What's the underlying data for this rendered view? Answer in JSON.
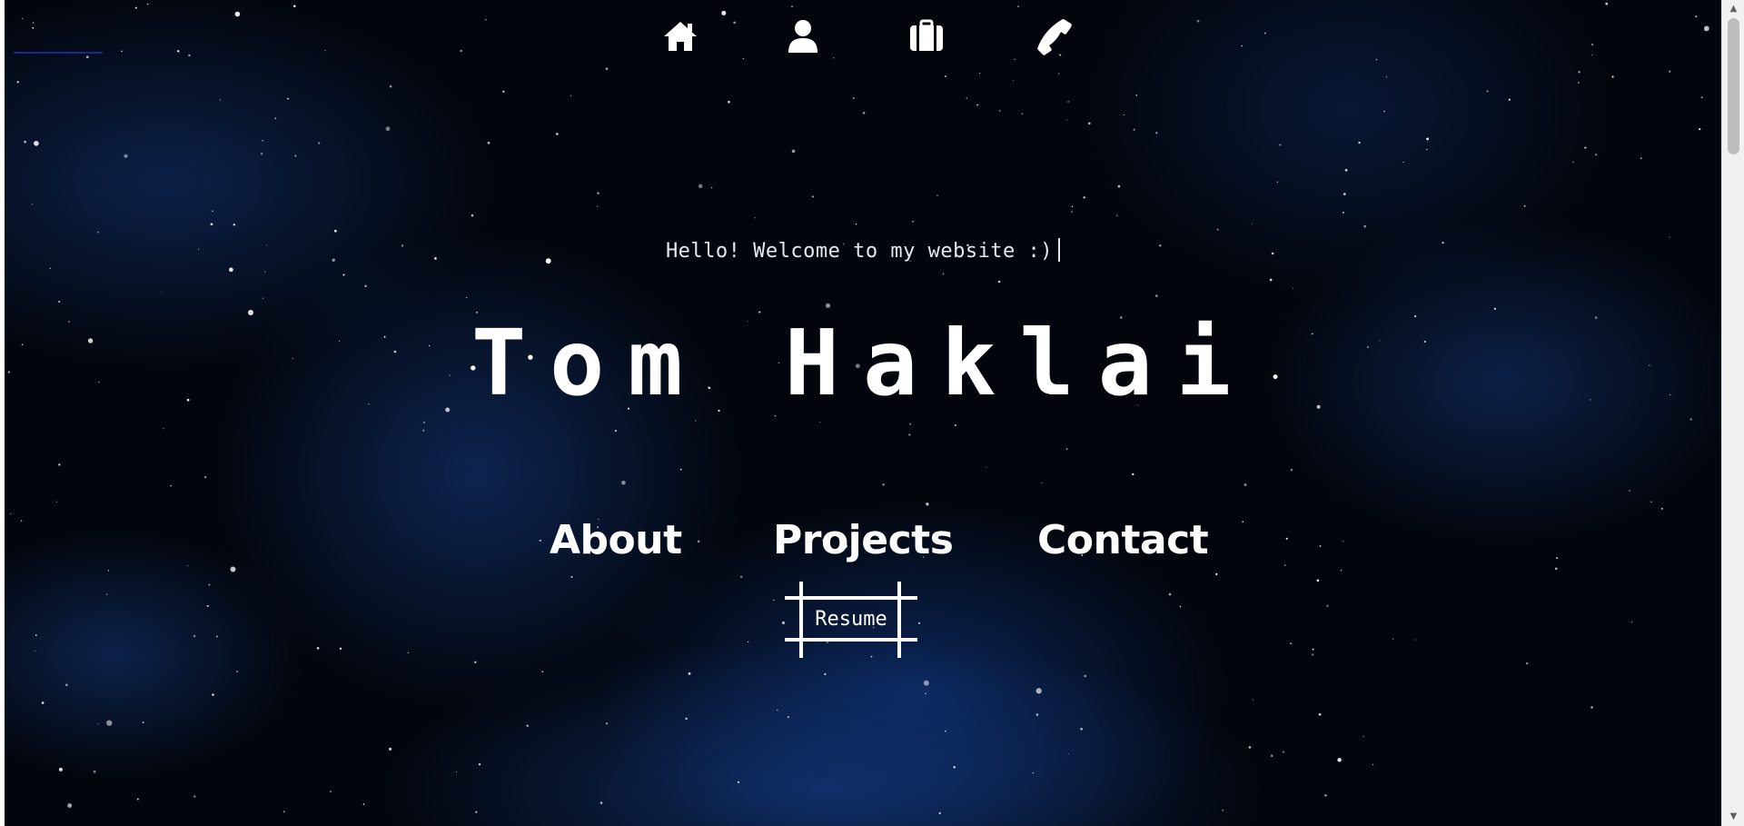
{
  "nav": {
    "icons": [
      {
        "name": "home-icon"
      },
      {
        "name": "user-icon"
      },
      {
        "name": "briefcase-icon"
      },
      {
        "name": "phone-icon"
      }
    ]
  },
  "hero": {
    "greeting": "Hello! Welcome to my website :)",
    "name": "Tom Haklai"
  },
  "menu": {
    "about": "About",
    "projects": "Projects",
    "contact": "Contact"
  },
  "resume": {
    "label": "Resume"
  },
  "colors": {
    "background": "#02050c",
    "nebula": "#1a4aa0",
    "text": "#ffffff"
  }
}
